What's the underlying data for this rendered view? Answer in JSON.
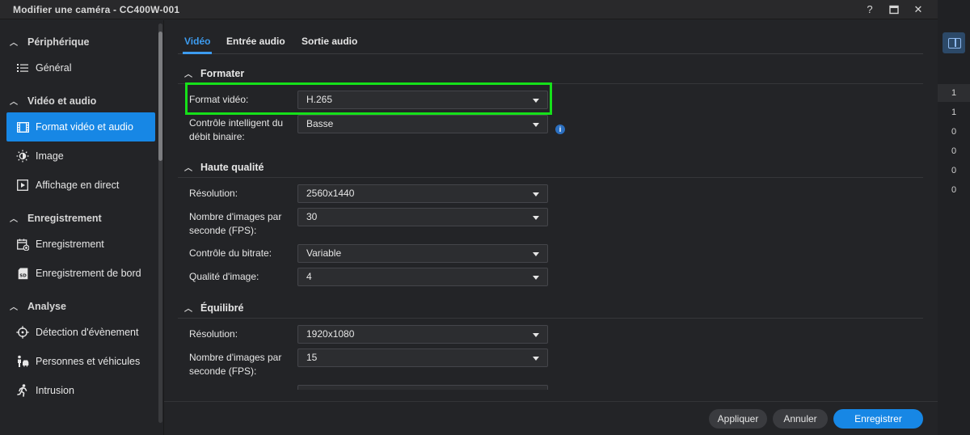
{
  "window": {
    "title": "Modifier une caméra - CC400W-001",
    "controls": {
      "help": "?",
      "maximize": "▭",
      "close": "✕"
    }
  },
  "sidebar": {
    "sections": [
      {
        "label": "Périphérique",
        "items": [
          {
            "label": "Général",
            "icon": "list-icon"
          }
        ]
      },
      {
        "label": "Vidéo et audio",
        "items": [
          {
            "label": "Format vidéo et audio",
            "icon": "film-icon",
            "active": true
          },
          {
            "label": "Image",
            "icon": "brightness-icon"
          },
          {
            "label": "Affichage en direct",
            "icon": "play-box-icon"
          }
        ]
      },
      {
        "label": "Enregistrement",
        "items": [
          {
            "label": "Enregistrement",
            "icon": "calendar-record-icon"
          },
          {
            "label": "Enregistrement de bord",
            "icon": "sd-card-icon"
          }
        ]
      },
      {
        "label": "Analyse",
        "items": [
          {
            "label": "Détection d'évènement",
            "icon": "crosshair-icon"
          },
          {
            "label": "Personnes et véhicules",
            "icon": "person-vehicle-icon"
          },
          {
            "label": "Intrusion",
            "icon": "running-person-icon"
          }
        ]
      }
    ]
  },
  "tabs": [
    {
      "label": "Vidéo",
      "active": true
    },
    {
      "label": "Entrée audio"
    },
    {
      "label": "Sortie audio"
    }
  ],
  "sections": {
    "formater": {
      "title": "Formater",
      "format_label": "Format vidéo:",
      "format_value": "H.265",
      "bitrate_control_label_1": "Contrôle intelligent du",
      "bitrate_control_label_2": "débit binaire:",
      "bitrate_control_value": "Basse",
      "info": "i"
    },
    "haute_qualite": {
      "title": "Haute qualité",
      "resolution_label": "Résolution:",
      "resolution_value": "2560x1440",
      "fps_label_1": "Nombre d'images par",
      "fps_label_2": "seconde (FPS):",
      "fps_value": "30",
      "bitrate_label": "Contrôle du bitrate:",
      "bitrate_value": "Variable",
      "quality_label": "Qualité d'image:",
      "quality_value": "4"
    },
    "equilibre": {
      "title": "Équilibré",
      "resolution_label": "Résolution:",
      "resolution_value": "1920x1080",
      "fps_label_1": "Nombre d'images par",
      "fps_label_2": "seconde (FPS):",
      "fps_value": "15"
    }
  },
  "footer": {
    "apply": "Appliquer",
    "cancel": "Annuler",
    "save": "Enregistrer"
  },
  "background_column": [
    "1",
    "1",
    "0",
    "0",
    "0",
    "0"
  ],
  "colors": {
    "accent": "#1787e5",
    "highlight": "#16e01a"
  }
}
